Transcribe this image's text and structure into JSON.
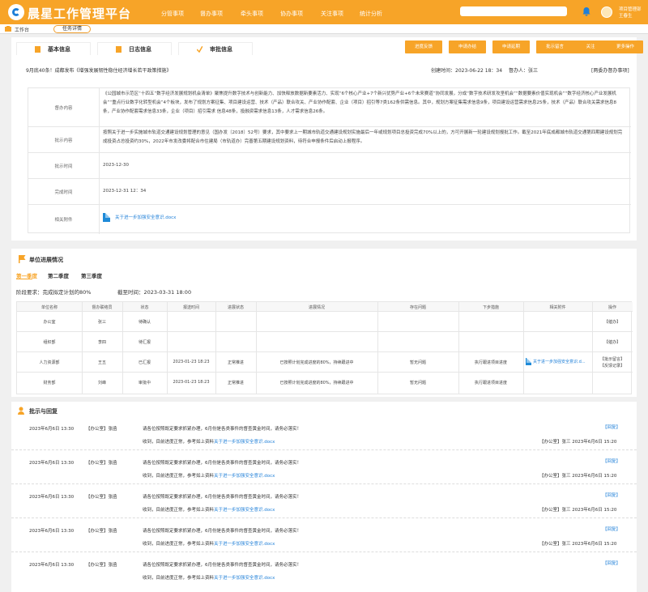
{
  "app": {
    "title": "晨星工作管理平台"
  },
  "nav": [
    "分管事项",
    "督办事项",
    "牵头事项",
    "协办事项",
    "关注事项",
    "统计分析"
  ],
  "user": {
    "dept": "项目管理部",
    "name": "王春生"
  },
  "tabs": {
    "home": "工作台",
    "current": "任务详情"
  },
  "sections": {
    "basic": "基本信息",
    "log": "日志信息",
    "approval": "审批信息"
  },
  "actions": [
    "进度反馈",
    "申请办结",
    "申请延期",
    "批示留言",
    "关注",
    "更多操作"
  ],
  "header": {
    "title": "9月底40条！成都发布《增强发展韧性稳住经济增长若干政策措施》",
    "created": "创建时间：2023-06-22  18：34",
    "supervisor": "督办人：张三",
    "back_link": "[两委办督办事项]"
  },
  "details": [
    {
      "label": "督办内容",
      "value": "《公园城市示范区“十四五”数字经济发展规划机会清单》聚焦提升数字技术与创新能力、加快释放数据新要素活力、实现“6个核心产业+7个新兴优势产业+6个未来赛道”协同发展，分成“数字技术研发攻坚机会”“数据要素价值实现机会”“数字经济核心产业发展机会”“重点行业数字化转型机会”4个板块，发布了规划方案征集、项目建设运营、技术（产品）联合攻关、产业协作配套、企业（项目）招引等7类162条供需信息。其中，规划方案征集需求信息9条，项目建设运营需求信息25条，技术（产品）联合攻关需求信息8条，产业协作配套需求信息33条，企业（项目）招引需求  信息48条，投融资需求信息13条，人才需求信息26条。"
    },
    {
      "label": "批示内容",
      "value": "按照关于进一步实施城市轨道交通建设规划管理的意见（国办发〔2018〕52号）要求，其中要求上一期城市轨道交通建设规划实施最后一年或规划项目总投资完成70%以上的，方可开展新一轮建设规划报批工作。截至2021年底成都城市轨道交通第四期建设规划完成投资占总投资约30%，2022年市发改委将配合市住建局（市轨道办）完善第五期建设规划资料，待符合申报条件后启动上报程序。"
    },
    {
      "label": "批示时间",
      "value": "2023-12-30"
    },
    {
      "label": "完成时间",
      "value": "2023-12-31  12：34"
    },
    {
      "label": "相关附件",
      "value": "关于进一步加强安全意识.docx"
    }
  ],
  "unit": {
    "title": "单位进展情况",
    "quarters": [
      "第一季度",
      "第二季度",
      "第三季度"
    ],
    "requirement": "阶段要求：完成拟定计划的80%",
    "deadline": "截至时间：2023-03-31 18:00",
    "columns": [
      "单位名称",
      "督办联络员",
      "状态",
      "报送时间",
      "进展状态",
      "进展情况",
      "存在问题",
      "下步措施",
      "相关附件",
      "操作"
    ],
    "rows": [
      {
        "unit": "办公室",
        "contact": "张三",
        "status": "待确认",
        "time": "",
        "progress_status": "",
        "progress": "",
        "issue": "",
        "next": "",
        "file": "",
        "ops": [
          "【催办】"
        ]
      },
      {
        "unit": "组织部",
        "contact": "李四",
        "status": "待汇报",
        "time": "",
        "progress_status": "",
        "progress": "",
        "issue": "",
        "next": "",
        "file": "",
        "ops": [
          "【催办】"
        ]
      },
      {
        "unit": "人力资源部",
        "contact": "王五",
        "status": "已汇报",
        "time": "2023-01-23 18:23",
        "progress_status": "正常推进",
        "progress": "已按照计划完成进度的80%，持续跟进中",
        "issue": "暂无问题",
        "next": "执行跟进项目进度",
        "file": "关于进一步加强安全意识.d...",
        "ops": [
          "【批示留言】",
          "【反馈记录】"
        ]
      },
      {
        "unit": "财务部",
        "contact": "刘峰",
        "status": "审批中",
        "time": "2023-01-23 18:23",
        "progress_status": "正常推进",
        "progress": "已按照计划完成进度的80%，持续跟进中",
        "issue": "暂无问题",
        "next": "执行跟进项目进度",
        "file": "",
        "ops": []
      }
    ]
  },
  "comments": {
    "title": "批示与回复",
    "items": [
      {
        "date": "2023年6月6日   13:30",
        "who": "【办公室】张函",
        "text": "请各位按照既定要求抓紧办理，6月份是各类事件的督查黄金时间，请务必落实！",
        "reply": "收到，目前进度正常，参考如上资料",
        "file": "关于进一步加强安全意识.docx",
        "reply_btn": "【回复】",
        "reply_meta": "【办公室】张三   2023年6月6日   15:20"
      },
      {
        "date": "2023年6月6日   13:30",
        "who": "【办公室】张函",
        "text": "请各位按照既定要求抓紧办理，6月份是各类事件的督查黄金时间，请务必落实！",
        "reply": "收到，目前进度正常，参考如上资料",
        "file": "关于进一步加强安全意识.docx",
        "reply_btn": "【回复】",
        "reply_meta": "【办公室】张三   2023年6月6日   15:20"
      },
      {
        "date": "2023年6月6日   13:30",
        "who": "【办公室】张函",
        "text": "请各位按照既定要求抓紧办理，6月份是各类事件的督查黄金时间，请务必落实！",
        "reply": "收到，目前进度正常，参考如上资料",
        "file": "关于进一步加强安全意识.docx",
        "reply_btn": "【回复】",
        "reply_meta": "【办公室】张三   2023年6月6日   15:20"
      },
      {
        "date": "2023年6月6日   13:30",
        "who": "【办公室】张函",
        "text": "请各位按照既定要求抓紧办理，6月份是各类事件的督查黄金时间，请务必落实！",
        "reply": "收到，目前进度正常，参考如上资料",
        "file": "关于进一步加强安全意识.docx",
        "reply_btn": "【回复】",
        "reply_meta": "【办公室】张三   2023年6月6日   15:20"
      },
      {
        "date": "2023年6月6日   13:30",
        "who": "【办公室】张函",
        "text": "请各位按照既定要求抓紧办理，6月份是各类事件的督查黄金时间，请务必落实！",
        "reply": "收到，目前进度正常，参考如上资料",
        "file": "关于进一步加强安全意识.docx",
        "reply_btn": "【回复】",
        "reply_meta": ""
      }
    ]
  },
  "colors": {
    "accent": "#f7a428",
    "link": "#1e7fd8"
  }
}
